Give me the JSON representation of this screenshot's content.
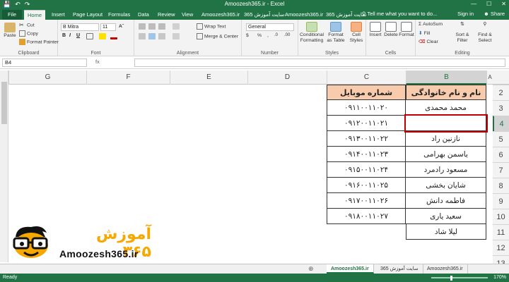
{
  "window": {
    "title": "Amoozesh365.ir - Excel",
    "controls": [
      "—",
      "☐",
      "✕"
    ]
  },
  "tabs": [
    "File",
    "Home",
    "Insert",
    "Page Layout",
    "Formulas",
    "Data",
    "Review",
    "View",
    "Amoozesh365.ir",
    "سایت آموزش 365",
    "Amoozesh365.ir",
    "سایت آموزش 365"
  ],
  "tell_me": "Tell me what you want to do...",
  "sign_in": "Sign in",
  "share": "Share",
  "ribbon": {
    "clipboard": {
      "label": "Clipboard",
      "paste": "Paste",
      "cut": "Cut",
      "copy": "Copy",
      "format_painter": "Format Painter"
    },
    "font": {
      "label": "Font",
      "name": "B Mitra",
      "size": "11"
    },
    "alignment": {
      "label": "Alignment",
      "wrap_text": "Wrap Text",
      "merge_center": "Merge & Center"
    },
    "number": {
      "label": "Number",
      "format": "General"
    },
    "styles": {
      "label": "Styles",
      "conditional": "Conditional Formatting",
      "format_table": "Format as Table",
      "cell_styles": "Cell Styles"
    },
    "cells": {
      "label": "Cells",
      "insert": "Insert",
      "delete": "Delete",
      "format": "Format"
    },
    "editing": {
      "label": "Editing",
      "autosum": "AutoSum",
      "fill": "Fill",
      "clear": "Clear",
      "sort_filter": "Sort & Filter",
      "find_select": "Find & Select"
    }
  },
  "name_box": "B4",
  "fx": "fx",
  "columns": [
    "G",
    "F",
    "E",
    "D",
    "C",
    "B",
    "A"
  ],
  "rows": [
    "2",
    "3",
    "4",
    "5",
    "6",
    "7",
    "8",
    "9",
    "10",
    "11",
    "12",
    "13"
  ],
  "table": {
    "header_name": "نام و نام خانوادگی",
    "header_phone": "شماره موبایل",
    "rows": [
      {
        "name": "محمد محمدی",
        "phone": "۰۹۱۱۰۰۱۱۰۲۰"
      },
      {
        "name": "",
        "phone": "۰۹۱۲۰۰۱۱۰۲۱"
      },
      {
        "name": "نازنین راد",
        "phone": "۰۹۱۳۰۰۱۱۰۲۲"
      },
      {
        "name": "یاسمن بهرامی",
        "phone": "۰۹۱۴۰۰۱۱۰۲۳"
      },
      {
        "name": "مسعود رادمرد",
        "phone": "۰۹۱۵۰۰۱۱۰۲۴"
      },
      {
        "name": "شایان بخشی",
        "phone": "۰۹۱۶۰۰۱۱۰۲۵"
      },
      {
        "name": "فاطمه دانش",
        "phone": "۰۹۱۷۰۰۱۱۰۲۶"
      },
      {
        "name": "سعید یاری",
        "phone": "۰۹۱۸۰۰۱۱۰۲۷"
      },
      {
        "name": "لیلا شاد",
        "phone": ""
      }
    ]
  },
  "logo": {
    "brand": "Amoozesh365.ir",
    "fa_text": "آموزش ۳۶۵"
  },
  "sheet_tabs": [
    "Amoozesh365.ir",
    "سایت آموزش 365",
    "Amoozesh365.ir"
  ],
  "add_sheet": "⊕",
  "status": {
    "ready": "Ready",
    "zoom": "170%"
  },
  "colors": {
    "excel_green": "#217346",
    "header_fill": "#f8cbad",
    "selection_border": "#c00000",
    "logo_orange": "#f6a800"
  }
}
